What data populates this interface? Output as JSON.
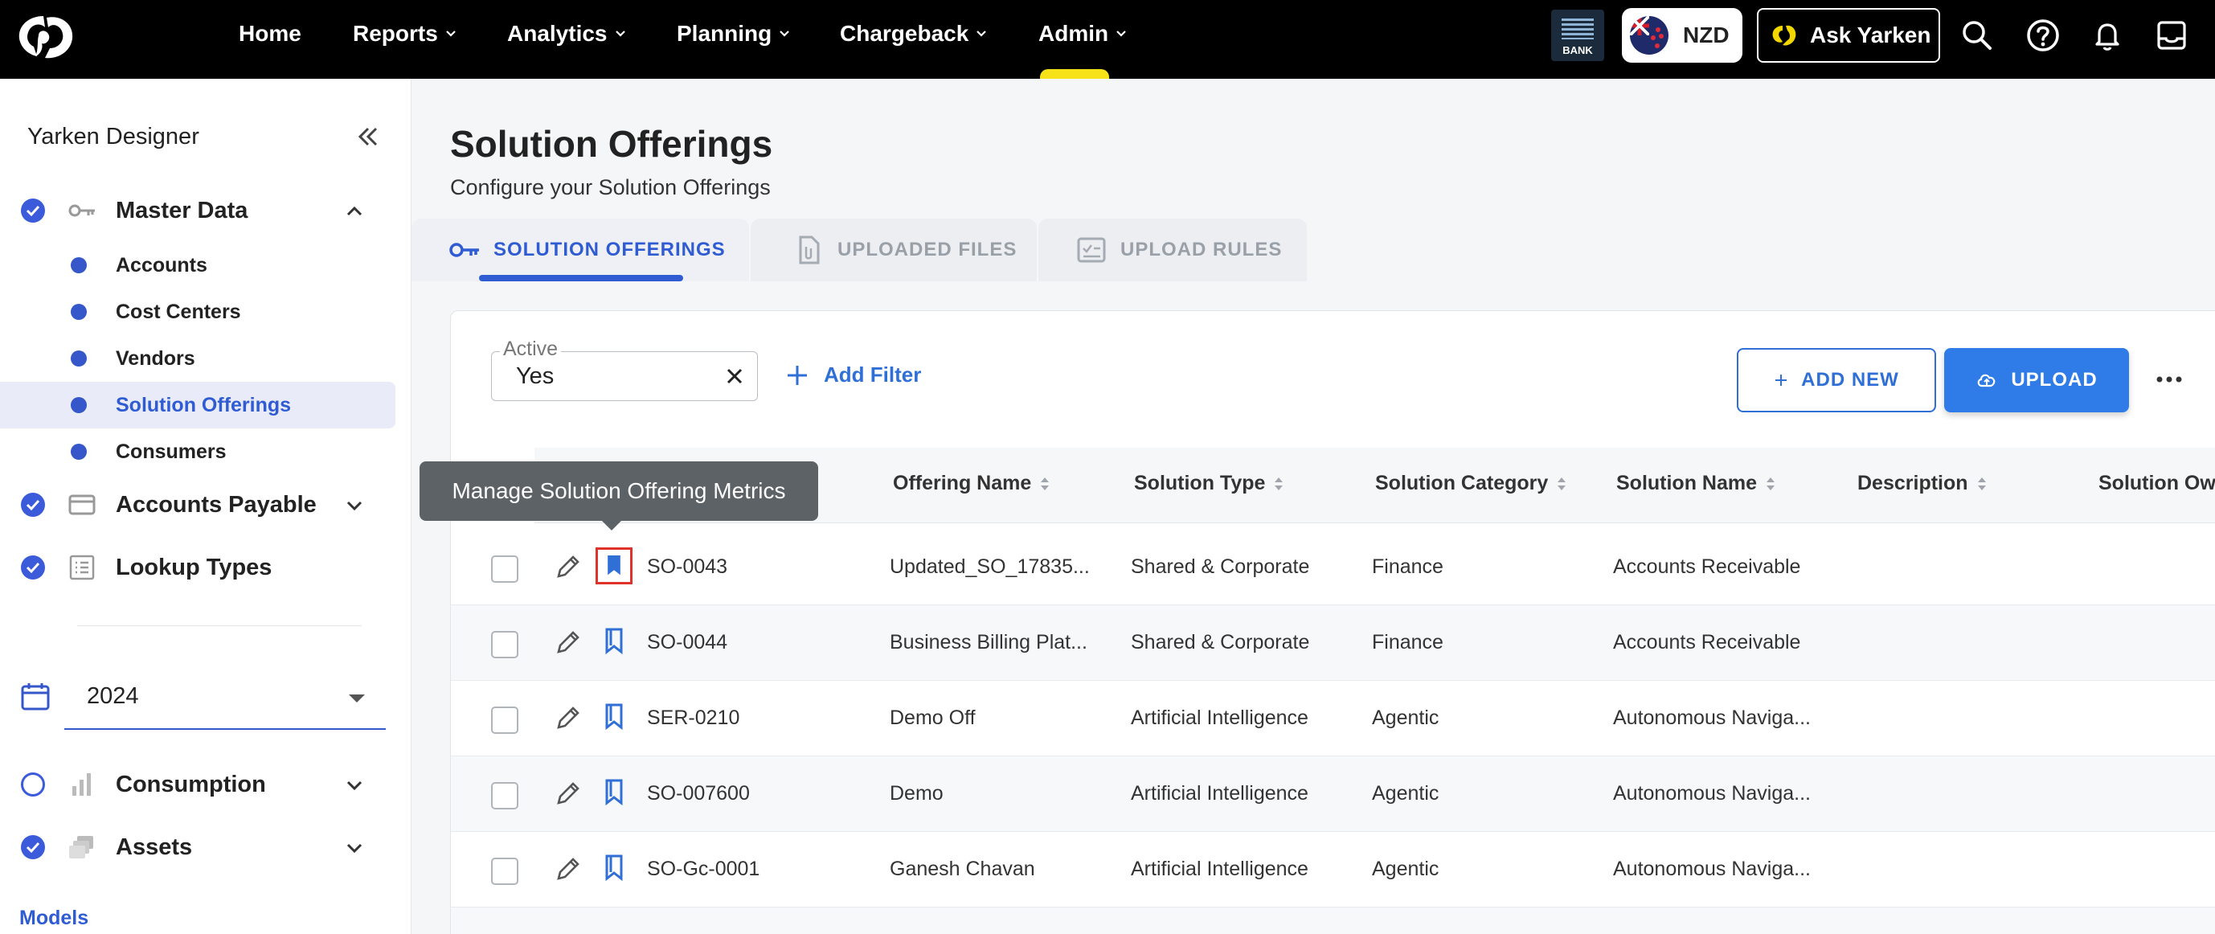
{
  "topbar": {
    "nav": [
      {
        "label": "Home",
        "dropdown": false
      },
      {
        "label": "Reports",
        "dropdown": true
      },
      {
        "label": "Analytics",
        "dropdown": true
      },
      {
        "label": "Planning",
        "dropdown": true
      },
      {
        "label": "Chargeback",
        "dropdown": true
      },
      {
        "label": "Admin",
        "dropdown": true
      }
    ],
    "bank_badge": "BANK",
    "currency": "NZD",
    "ask_label": "Ask Yarken"
  },
  "sidebar": {
    "title": "Yarken Designer",
    "master_data": {
      "label": "Master Data",
      "items": [
        {
          "label": "Accounts"
        },
        {
          "label": "Cost Centers"
        },
        {
          "label": "Vendors"
        },
        {
          "label": "Solution Offerings"
        },
        {
          "label": "Consumers"
        }
      ]
    },
    "accounts_payable": "Accounts Payable",
    "lookup_types": "Lookup Types",
    "year": "2024",
    "consumption": "Consumption",
    "assets": "Assets",
    "models": "Models"
  },
  "page": {
    "title": "Solution Offerings",
    "subtitle": "Configure your Solution Offerings"
  },
  "tabs": [
    {
      "label": "SOLUTION OFFERINGS"
    },
    {
      "label": "UPLOADED FILES"
    },
    {
      "label": "UPLOAD RULES"
    }
  ],
  "toolbar": {
    "filter_label": "Active",
    "filter_value": "Yes",
    "add_filter": "Add Filter",
    "add_new": "ADD NEW",
    "upload": "UPLOAD"
  },
  "tooltip": "Manage Solution Offering Metrics",
  "table": {
    "columns": [
      "Offering Name",
      "Solution Type",
      "Solution Category",
      "Solution Name",
      "Description",
      "Solution Own"
    ],
    "rows": [
      {
        "code": "SO-0043",
        "name": "Updated_SO_17835...",
        "type": "Shared & Corporate",
        "category": "Finance",
        "solution": "Accounts Receivable"
      },
      {
        "code": "SO-0044",
        "name": "Business Billing Plat...",
        "type": "Shared & Corporate",
        "category": "Finance",
        "solution": "Accounts Receivable"
      },
      {
        "code": "SER-0210",
        "name": "Demo Off",
        "type": "Artificial Intelligence",
        "category": "Agentic",
        "solution": "Autonomous Naviga..."
      },
      {
        "code": "SO-007600",
        "name": "Demo",
        "type": "Artificial Intelligence",
        "category": "Agentic",
        "solution": "Autonomous Naviga..."
      },
      {
        "code": "SO-Gc-0001",
        "name": "Ganesh Chavan",
        "type": "Artificial Intelligence",
        "category": "Agentic",
        "solution": "Autonomous Naviga..."
      }
    ]
  },
  "colors": {
    "accent": "#2f5bd3",
    "primary_button": "#2f7be8",
    "topbar": "#000000",
    "highlight": "#e0312a"
  }
}
